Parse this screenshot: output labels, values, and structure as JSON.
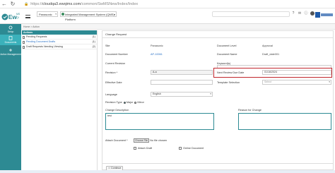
{
  "browser": {
    "url_prefix": "https://",
    "url_host": "cloudqa3.ewqims.com",
    "url_path": "/common/SwMSNew/Index/Index"
  },
  "appbar": {
    "org": "Panasonic",
    "platform": "Integrated Management System (QMS) Platform"
  },
  "sidebar": {
    "items": [
      {
        "label": "Setup"
      },
      {
        "label": "Documents"
      },
      {
        "label": "Action Management"
      }
    ]
  },
  "breadcrumb": "Home > Action",
  "actions": {
    "title": "Actions",
    "items": [
      {
        "label": "Pending Requests",
        "count": "(1)"
      },
      {
        "label": "Pending Document Drafts",
        "count": "(1)"
      },
      {
        "label": "Draft Requests Needing Viewing",
        "count": "(2)"
      }
    ]
  },
  "form": {
    "title": "Change Request",
    "site_label": "Site",
    "site_value": "Panasonic",
    "doc_level_label": "Document Level",
    "doc_level_value": "Approval",
    "doc_number_label": "Document Number",
    "doc_number_value": "AP-10061",
    "doc_name_label": "Document Name",
    "doc_name_value": "Draft_date001",
    "current_revision_label": "Current Revision",
    "keywords_label": "Keyword(s)",
    "revision_label": "Revision *",
    "revision_value": "A-a",
    "review_due_label": "Next Review Due Date",
    "review_due_value": "01/16/2024",
    "effective_date_label": "Effective Date",
    "template_label": "Template Selection",
    "template_placeholder": "Select",
    "language_label": "Language",
    "language_value": "English",
    "revision_type_label": "Revision Type",
    "major_label": "Major",
    "minor_label": "Minor",
    "change_desc_label": "Change Description",
    "change_desc_value": "test",
    "reason_label": "Reason for Change",
    "attach_label": "Attach Document *",
    "choose_file": "Choose File",
    "no_file": "No file chosen",
    "attach_draft_label": "Attach Draft",
    "online_doc_label": "Online Document",
    "continue_label": "Continue"
  }
}
